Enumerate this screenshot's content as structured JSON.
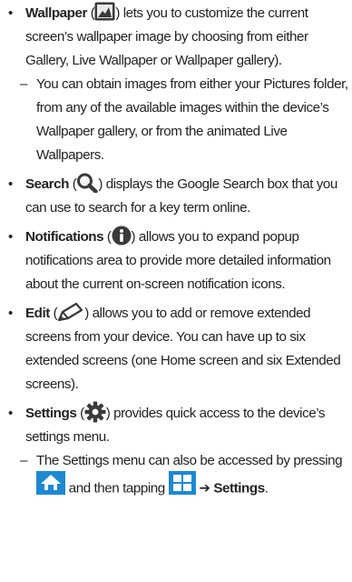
{
  "colors": {
    "text": "#222222",
    "icon_dark": "#3a3a3a",
    "home_bg": "#1e88d0",
    "apps_bg": "#1e88d0"
  },
  "icons": {
    "wallpaper": "wallpaper-icon",
    "search": "magnifier-icon",
    "notifications": "info-icon",
    "edit": "pencil-icon",
    "settings": "gear-icon",
    "home": "home-key-icon",
    "apps": "apps-grid-icon"
  },
  "wallpaper": {
    "bullet": "•",
    "term": "Wallpaper",
    "open": " (",
    "close": ") lets you to customize the current screen’s wallpaper image by choosing from either Gallery, Live Wallpaper or Wallpaper gallery).",
    "sub": {
      "dash": "–",
      "text": "You can obtain images from either your Pictures folder, from any of the available images within the device’s Wallpaper gallery, or from the animated Live Wallpapers."
    }
  },
  "search": {
    "bullet": "•",
    "term": "Search",
    "open": " (",
    "close": ") displays the Google Search box that you can use to search for a key term online."
  },
  "notifications": {
    "bullet": "•",
    "term": "Notifications",
    "open": " (",
    "close": ") allows you to expand popup notifications area to provide more detailed information about the current on-screen notification icons."
  },
  "edit": {
    "bullet": "•",
    "term": "Edit",
    "open": " (",
    "close": ") allows you to add or remove extended screens from your device. You can have up to six extended screens (one Home screen and six Extended screens)."
  },
  "settings": {
    "bullet": "•",
    "term": "Settings",
    "open": " (",
    "close": ") provides quick access to the device’s settings menu.",
    "sub": {
      "dash": "–",
      "before": "The Settings menu can also be accessed by pressing",
      "middle": "and then tapping",
      "arrow": "➔",
      "after": "Settings",
      "period": "."
    }
  }
}
